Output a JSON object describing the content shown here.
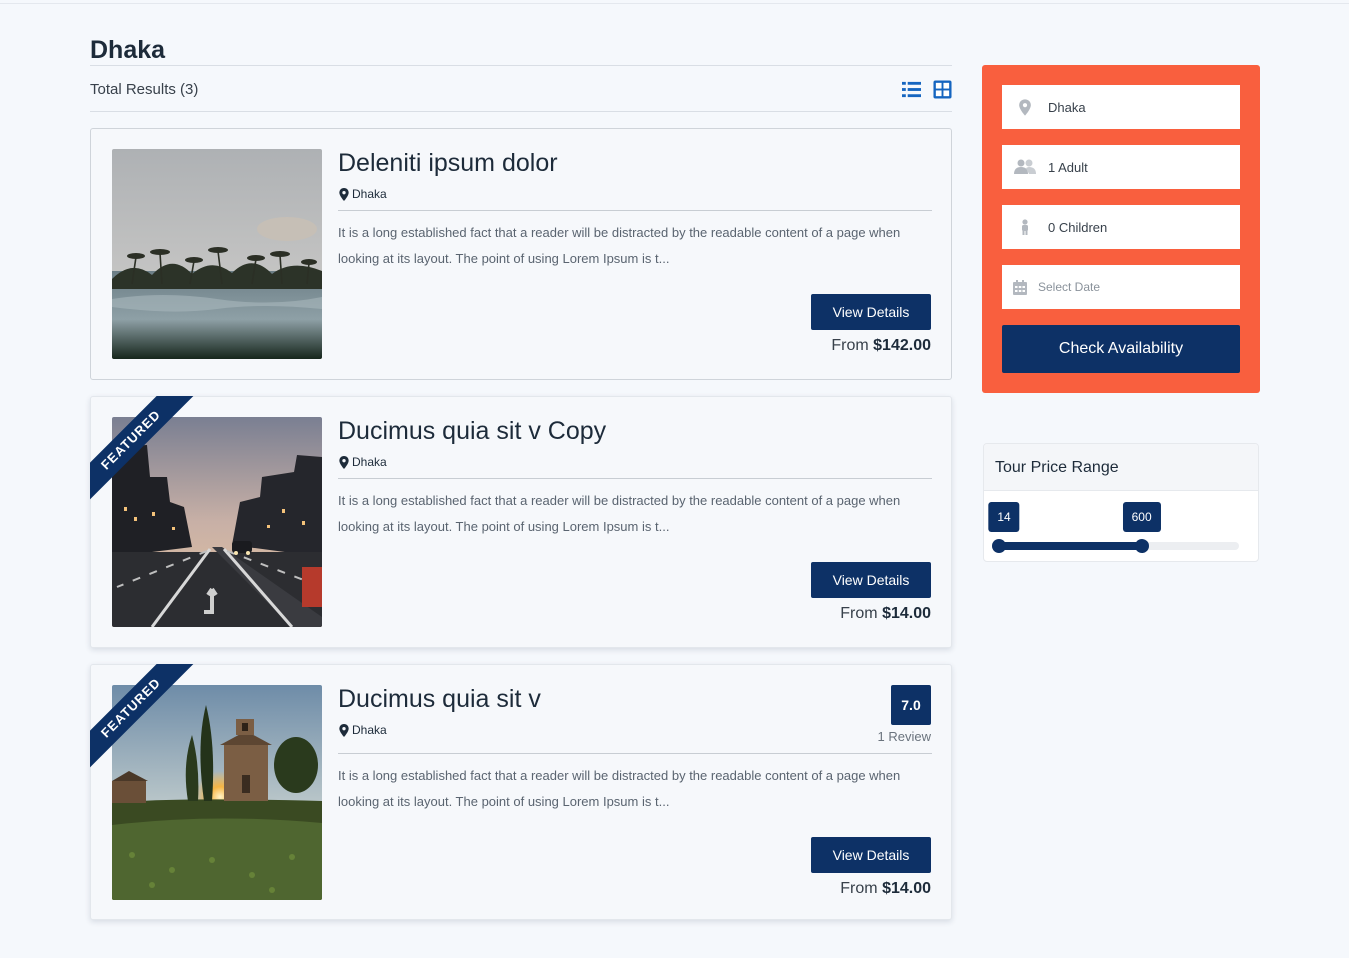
{
  "header": {
    "city": "Dhaka",
    "total_results": "Total Results (3)"
  },
  "view_toggle": {
    "list_icon": "list-icon",
    "grid_icon": "grid-icon",
    "color": "#1565c0"
  },
  "tours": [
    {
      "title": "Deleniti ipsum dolor",
      "location": "Dhaka",
      "description": "It is a long established fact that a reader will be distracted by the readable content of a page when looking at its layout. The point of using Lorem Ipsum is t...",
      "button_label": "View Details",
      "price_prefix": "From",
      "price": "$142.00",
      "featured": false,
      "image": "beach-palms-image"
    },
    {
      "title": "Ducimus quia sit v Copy",
      "location": "Dhaka",
      "description": "It is a long established fact that a reader will be distracted by the readable content of a page when looking at its layout. The point of using Lorem Ipsum is t...",
      "button_label": "View Details",
      "price_prefix": "From",
      "price": "$14.00",
      "featured": true,
      "featured_label": "FEATURED",
      "image": "city-street-image"
    },
    {
      "title": "Ducimus quia sit v",
      "location": "Dhaka",
      "description": "It is a long established fact that a reader will be distracted by the readable content of a page when looking at its layout. The point of using Lorem Ipsum is t...",
      "button_label": "View Details",
      "price_prefix": "From",
      "price": "$14.00",
      "featured": true,
      "featured_label": "FEATURED",
      "rating": "7.0",
      "reviews": "1 Review",
      "image": "countryside-chapel-image"
    }
  ],
  "search": {
    "location_value": "Dhaka",
    "adults_value": "1 Adult",
    "children_value": "0 Children",
    "date_placeholder": "Select Date",
    "check_label": "Check Availability",
    "bg_color": "#f95f3e"
  },
  "price_range": {
    "title": "Tour Price Range",
    "scale_min": 14,
    "scale_max": 1000,
    "min_label": "14",
    "max_label": "600",
    "min_value": 14,
    "max_value": 600
  },
  "colors": {
    "primary": "#0d3166",
    "accent": "#f95f3e",
    "background": "#f5f8fc"
  }
}
